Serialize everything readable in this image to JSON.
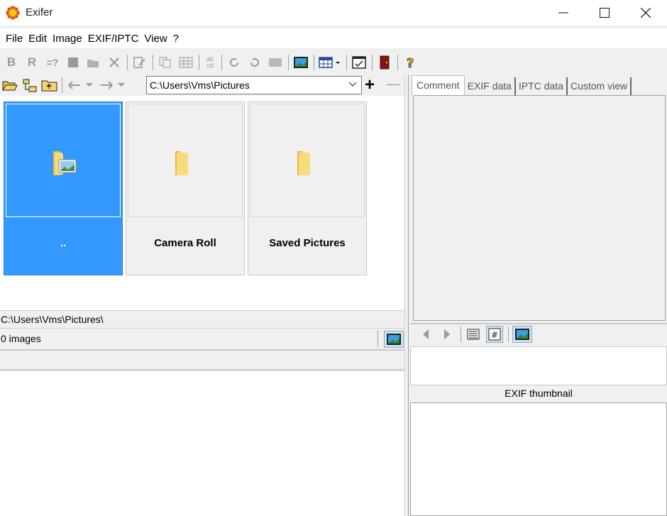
{
  "window": {
    "title": "Exifer",
    "controls": {
      "minimize": "minimize",
      "maximize": "maximize",
      "close": "close"
    }
  },
  "menu": [
    "File",
    "Edit",
    "Image",
    "EXIF/IPTC",
    "View",
    "?"
  ],
  "toolbar": {
    "bold_label": "B",
    "rename_label": "R",
    "compare_label": "=?",
    "abcd_label": "ab cd"
  },
  "navigation": {
    "path": "C:\\Users\\Vms\\Pictures",
    "add_label": "+",
    "remove_label": "—"
  },
  "folders": [
    {
      "label": "..",
      "selected": true,
      "icon": "folder-image-icon"
    },
    {
      "label": "Camera Roll",
      "selected": false,
      "icon": "folder-icon"
    },
    {
      "label": "Saved Pictures",
      "selected": false,
      "icon": "folder-icon"
    }
  ],
  "status": {
    "current_path": "C:\\Users\\Vms\\Pictures\\",
    "image_count": "0 images"
  },
  "tabs": [
    {
      "label": "Comment",
      "active": true
    },
    {
      "label": "EXIF data",
      "active": false
    },
    {
      "label": "IPTC data",
      "active": false
    },
    {
      "label": "Custom view",
      "active": false
    }
  ],
  "right_panel": {
    "thumbnail_title": "EXIF thumbnail"
  },
  "colors": {
    "selection": "#3399ff",
    "folder": "#f5d56b"
  }
}
